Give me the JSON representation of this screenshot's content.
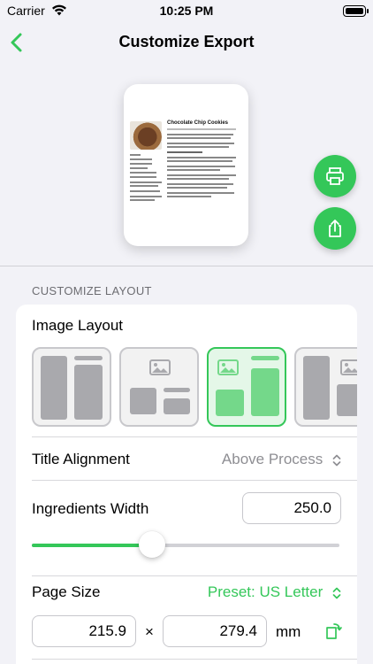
{
  "status_bar": {
    "carrier": "Carrier",
    "time": "10:25 PM"
  },
  "nav": {
    "title": "Customize Export",
    "back_icon": "chevron-left-icon"
  },
  "preview": {
    "recipe_title": "Chocolate Chip Cookies",
    "actions": {
      "print_icon": "printer-icon",
      "share_icon": "share-icon"
    }
  },
  "section": {
    "header": "CUSTOMIZE LAYOUT"
  },
  "image_layout": {
    "label": "Image Layout",
    "selected_index": 2
  },
  "title_alignment": {
    "label": "Title Alignment",
    "value": "Above Process"
  },
  "ingredients_width": {
    "label": "Ingredients Width",
    "value": "250.0",
    "slider_fraction": 0.39
  },
  "page_size": {
    "label": "Page Size",
    "preset": "Preset: US Letter",
    "width": "215.9",
    "times": "×",
    "height": "279.4",
    "unit": "mm",
    "rotate_icon": "rotate-icon"
  },
  "colors": {
    "accent": "#34c759",
    "background": "#f2f2f7"
  }
}
